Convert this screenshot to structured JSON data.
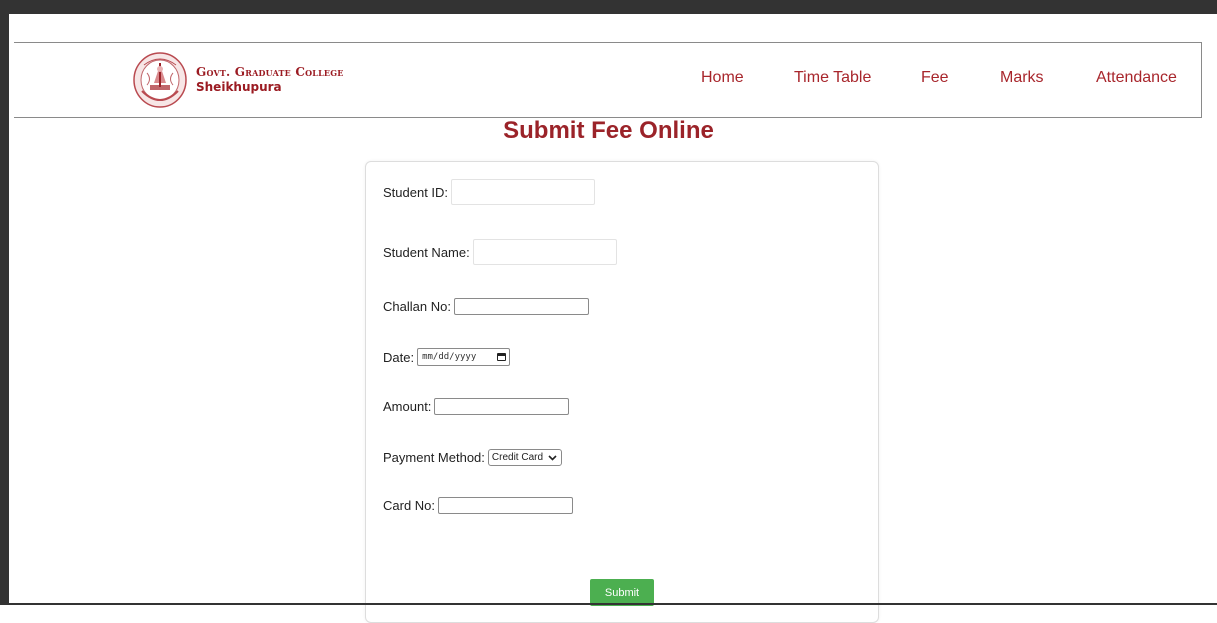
{
  "header": {
    "college_name_line1": "Govt. Graduate College",
    "college_name_line2": "Sheikhupura",
    "nav": [
      "Home",
      "Time Table",
      "Fee",
      "Marks",
      "Attendance"
    ]
  },
  "page": {
    "title": "Submit Fee Online"
  },
  "form": {
    "student_id_label": "Student ID:",
    "student_id_value": "",
    "student_name_label": "Student Name:",
    "student_name_value": "",
    "challan_label": "Challan No:",
    "challan_value": "",
    "date_label": "Date:",
    "date_placeholder": "mm/dd/yyyy",
    "amount_label": "Amount:",
    "amount_value": "",
    "payment_label": "Payment Method:",
    "payment_selected": "Credit Card",
    "card_label": "Card No:",
    "card_value": "",
    "submit_label": "Submit"
  },
  "colors": {
    "brand": "#9b2329",
    "nav_text": "#a8262c",
    "submit_bg": "#4caf50",
    "frame": "#333333"
  },
  "icons": {
    "logo": "college-seal-icon",
    "date_picker": "calendar-icon",
    "dropdown": "chevron-down-icon"
  }
}
